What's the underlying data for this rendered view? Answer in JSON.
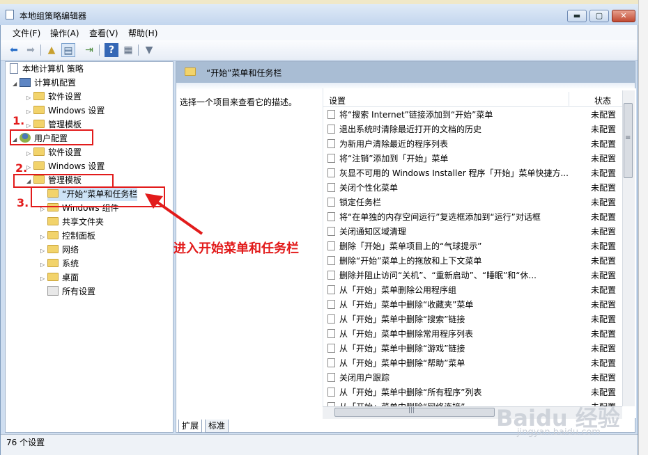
{
  "window": {
    "title": "本地组策略编辑器",
    "min": "▬",
    "max": "▢",
    "close": "✕"
  },
  "menu": [
    "文件(F)",
    "操作(A)",
    "查看(V)",
    "帮助(H)"
  ],
  "tree": {
    "root": "本地计算机 策略",
    "computer": "计算机配置",
    "c_software": "软件设置",
    "c_windows": "Windows 设置",
    "c_admin": "管理模板",
    "user": "用户配置",
    "u_software": "软件设置",
    "u_windows": "Windows 设置",
    "u_admin": "管理模板",
    "start_menu": "“开始”菜单和任务栏",
    "win_components": "Windows 组件",
    "shared": "共享文件夹",
    "control": "控制面板",
    "network": "网络",
    "system": "系统",
    "desktop": "桌面",
    "all": "所有设置"
  },
  "right": {
    "header_title": "“开始”菜单和任务栏",
    "description": "选择一个项目来查看它的描述。",
    "col_setting": "设置",
    "col_state": "状态",
    "rows": [
      {
        "name": "将“搜索 Internet”链接添加到“开始”菜单",
        "state": "未配置"
      },
      {
        "name": "退出系统时清除最近打开的文档的历史",
        "state": "未配置"
      },
      {
        "name": "为新用户清除最近的程序列表",
        "state": "未配置"
      },
      {
        "name": "将“注销”添加到「开始」菜单",
        "state": "未配置"
      },
      {
        "name": "灰显不可用的 Windows Installer 程序「开始」菜单快捷方...",
        "state": "未配置"
      },
      {
        "name": "关闭个性化菜单",
        "state": "未配置"
      },
      {
        "name": "锁定任务栏",
        "state": "未配置"
      },
      {
        "name": "将“在单独的内存空间运行”复选框添加到“运行”对话框",
        "state": "未配置"
      },
      {
        "name": "关闭通知区域清理",
        "state": "未配置"
      },
      {
        "name": "删除「开始」菜单项目上的“气球提示”",
        "state": "未配置"
      },
      {
        "name": "删除“开始”菜单上的拖放和上下文菜单",
        "state": "未配置"
      },
      {
        "name": "删除并阻止访问“关机”、“重新启动”、“睡眠”和“休...",
        "state": "未配置"
      },
      {
        "name": "从「开始」菜单删除公用程序组",
        "state": "未配置"
      },
      {
        "name": "从「开始」菜单中删除“收藏夹”菜单",
        "state": "未配置"
      },
      {
        "name": "从「开始」菜单中删除“搜索”链接",
        "state": "未配置"
      },
      {
        "name": "从「开始」菜单中删除常用程序列表",
        "state": "未配置"
      },
      {
        "name": "从「开始」菜单中删除“游戏”链接",
        "state": "未配置"
      },
      {
        "name": "从「开始」菜单中删除“帮助”菜单",
        "state": "未配置"
      },
      {
        "name": "关闭用户跟踪",
        "state": "未配置"
      },
      {
        "name": "从「开始」菜单中删除“所有程序”列表",
        "state": "未配置"
      },
      {
        "name": "从「开始」菜单中删除“网络连接”",
        "state": "未配置"
      }
    ],
    "scroll_grip": "≡",
    "hscroll_grip": "|||"
  },
  "tabs": [
    "扩展",
    "标准"
  ],
  "status": "76 个设置",
  "annotations": {
    "n1": "1.",
    "n2": "2.",
    "n3": "3.",
    "text": "进入开始菜单和任务栏"
  },
  "watermark": {
    "brand": "Baidu 经验",
    "url": "jingyan.baidu.com"
  },
  "colors": {
    "accent_red": "#e21b1b",
    "header_bg": "#a9bdd4"
  }
}
